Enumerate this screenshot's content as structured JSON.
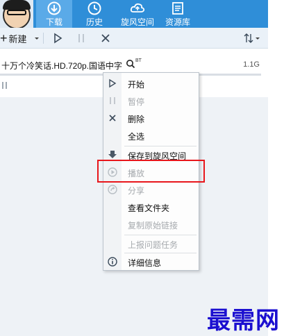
{
  "colors": {
    "accent": "#2f8ed8",
    "highlight": "#e8161b",
    "watermark": "#1b0fd0",
    "disabled": "#a6aaae"
  },
  "nav": {
    "tabs": [
      {
        "label": "下载",
        "icon": "download-icon",
        "active": true
      },
      {
        "label": "历史",
        "icon": "history-icon",
        "active": false
      },
      {
        "label": "旋风空间",
        "icon": "cloud-space-icon",
        "active": false
      },
      {
        "label": "资源库",
        "icon": "library-icon",
        "active": false
      }
    ]
  },
  "toolbar": {
    "new_label": "新建",
    "icons": [
      "plus-icon",
      "dropdown-arrow-icon",
      "play-icon",
      "pause-icon",
      "close-icon",
      "sort-icon"
    ]
  },
  "task": {
    "name": "十万个冷笑话.HD.720p.国语中字",
    "tag": "BT",
    "size": "1.1G"
  },
  "context_menu": {
    "items": [
      {
        "label": "开始",
        "icon": "play-icon",
        "disabled": false
      },
      {
        "label": "暂停",
        "icon": "pause-icon",
        "disabled": true
      },
      {
        "label": "删除",
        "icon": "close-icon",
        "disabled": false
      },
      {
        "label": "全选",
        "icon": "",
        "disabled": false
      },
      {
        "label": "保存到旋风空间",
        "icon": "download-arrow-icon",
        "disabled": false
      },
      {
        "label": "播放",
        "icon": "play-circle-icon",
        "disabled": true
      },
      {
        "label": "分享",
        "icon": "share-icon",
        "disabled": true
      },
      {
        "label": "查看文件夹",
        "icon": "",
        "disabled": false
      },
      {
        "label": "复制原始链接",
        "icon": "",
        "disabled": true
      },
      {
        "label": "上报问题任务",
        "icon": "",
        "disabled": true
      },
      {
        "label": "详细信息",
        "icon": "info-icon",
        "disabled": false
      }
    ]
  },
  "watermark": "最需网"
}
